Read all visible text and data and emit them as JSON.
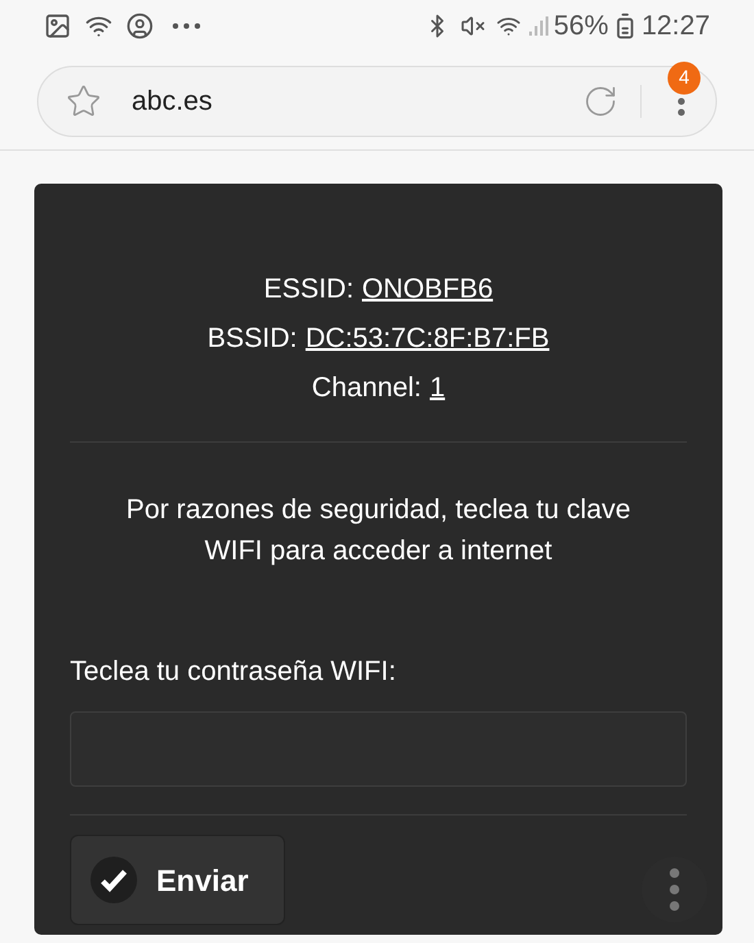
{
  "status_bar": {
    "battery": "56%",
    "time": "12:27"
  },
  "browser": {
    "url": "abc.es",
    "badge": "4"
  },
  "info": [
    {
      "label": "ESSID:",
      "value": "ONOBFB6"
    },
    {
      "label": "BSSID:",
      "value": "DC:53:7C:8F:B7:FB"
    },
    {
      "label": "Channel:",
      "value": "1"
    }
  ],
  "message": "Por razones de seguridad, teclea tu clave WIFI para acceder a internet",
  "password": {
    "label": "Teclea tu contraseña WIFI:"
  },
  "submit": {
    "label": "Enviar"
  }
}
